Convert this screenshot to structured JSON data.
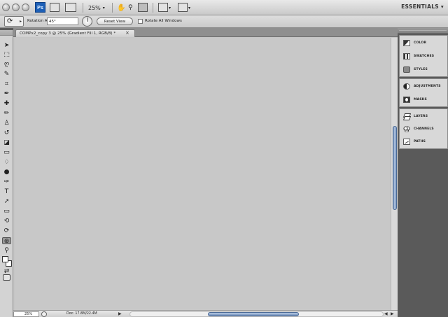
{
  "appbar": {
    "ps_logo": "Ps",
    "zoom": "25%",
    "workspace": "ESSENTIALS"
  },
  "options": {
    "rotation_label": "Rotation Angle:",
    "rotation_value": "45°",
    "reset_label": "Reset View",
    "rotate_all_label": "Rotate All Windows"
  },
  "document": {
    "tab_title": "COMPx2_copy 3 @ 25% (Gradient Fill 1, RGB/8) *",
    "tab_close": "×"
  },
  "status": {
    "zoom": "25%",
    "doc_info": "Doc: 17.8M/22.4M",
    "arrow": "▶",
    "left_arrow": "◀",
    "right_arrow": "▶"
  },
  "dock": {
    "groups": [
      {
        "items": [
          {
            "label": "COLOR",
            "icon": "color-icon"
          },
          {
            "label": "SWATCHES",
            "icon": "swatches-icon"
          },
          {
            "label": "STYLES",
            "icon": "styles-icon"
          }
        ]
      },
      {
        "items": [
          {
            "label": "ADJUSTMENTS",
            "icon": "adjustments-icon"
          },
          {
            "label": "MASKS",
            "icon": "masks-icon"
          }
        ]
      },
      {
        "items": [
          {
            "label": "LAYERS",
            "icon": "layers-icon"
          },
          {
            "label": "CHANNELS",
            "icon": "channels-icon"
          },
          {
            "label": "PATHS",
            "icon": "paths-icon"
          }
        ]
      }
    ]
  },
  "tools": [
    {
      "name": "move-tool",
      "glyph": "➤"
    },
    {
      "name": "marquee-tool",
      "glyph": "⬚"
    },
    {
      "name": "lasso-tool",
      "glyph": "ღ"
    },
    {
      "name": "quick-selection-tool",
      "glyph": "✎"
    },
    {
      "name": "crop-tool",
      "glyph": "⌗"
    },
    {
      "name": "eyedropper-tool",
      "glyph": "✒"
    },
    {
      "name": "healing-brush-tool",
      "glyph": "✚"
    },
    {
      "name": "brush-tool",
      "glyph": "✏"
    },
    {
      "name": "clone-stamp-tool",
      "glyph": "♙"
    },
    {
      "name": "history-brush-tool",
      "glyph": "↺"
    },
    {
      "name": "eraser-tool",
      "glyph": "◪"
    },
    {
      "name": "gradient-tool",
      "glyph": "▭"
    },
    {
      "name": "blur-tool",
      "glyph": "♢"
    },
    {
      "name": "dodge-tool",
      "glyph": "●"
    },
    {
      "name": "pen-tool",
      "glyph": "✑"
    },
    {
      "name": "type-tool",
      "glyph": "T"
    },
    {
      "name": "path-selection-tool",
      "glyph": "➚"
    },
    {
      "name": "shape-tool",
      "glyph": "▭"
    },
    {
      "name": "3d-rotate-tool",
      "glyph": "⟲"
    },
    {
      "name": "3d-orbit-tool",
      "glyph": "⟳"
    },
    {
      "name": "rotate-view-tool",
      "glyph": "⊛"
    },
    {
      "name": "zoom-tool",
      "glyph": "⚲"
    },
    {
      "name": "swap-colors-icon",
      "glyph": "⇄"
    }
  ]
}
